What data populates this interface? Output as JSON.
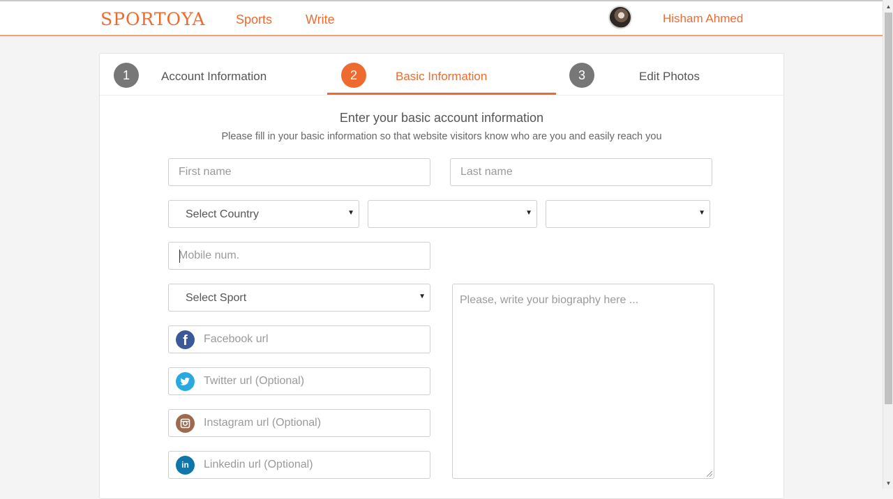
{
  "header": {
    "logo": "SPORTOYA",
    "nav": [
      {
        "label": "Sports"
      },
      {
        "label": "Write"
      }
    ],
    "user_name": "Hisham Ahmed"
  },
  "steps": [
    {
      "number": "1",
      "label": "Account Information",
      "active": false
    },
    {
      "number": "2",
      "label": "Basic Information",
      "active": true
    },
    {
      "number": "3",
      "label": "Edit Photos",
      "active": false
    }
  ],
  "form": {
    "title": "Enter your basic account information",
    "subtitle": "Please fill in your basic information so that website visitors know who are you and easily reach you",
    "first_name": {
      "placeholder": "First name",
      "value": ""
    },
    "last_name": {
      "placeholder": "Last name",
      "value": ""
    },
    "country_select": {
      "value": "Select Country"
    },
    "city_select": {
      "value": ""
    },
    "area_select": {
      "value": ""
    },
    "mobile": {
      "placeholder": "Mobile num.",
      "value": ""
    },
    "sport_select": {
      "value": "Select Sport"
    },
    "facebook": {
      "placeholder": "Facebook url",
      "icon": "facebook-icon"
    },
    "twitter": {
      "placeholder": "Twitter url (Optional)",
      "icon": "twitter-icon"
    },
    "instagram": {
      "placeholder": "Instagram url (Optional)",
      "icon": "instagram-icon"
    },
    "linkedin": {
      "placeholder": "Linkedin url (Optional)",
      "icon": "linkedin-icon"
    },
    "biography": {
      "placeholder": "Please, write your biography here ...",
      "value": ""
    }
  },
  "colors": {
    "accent": "#ef6a2f",
    "step_inactive": "#777777",
    "facebook": "#3b5998",
    "twitter": "#2aa9e0",
    "instagram": "#9b6a4f",
    "linkedin": "#0e76a8"
  }
}
